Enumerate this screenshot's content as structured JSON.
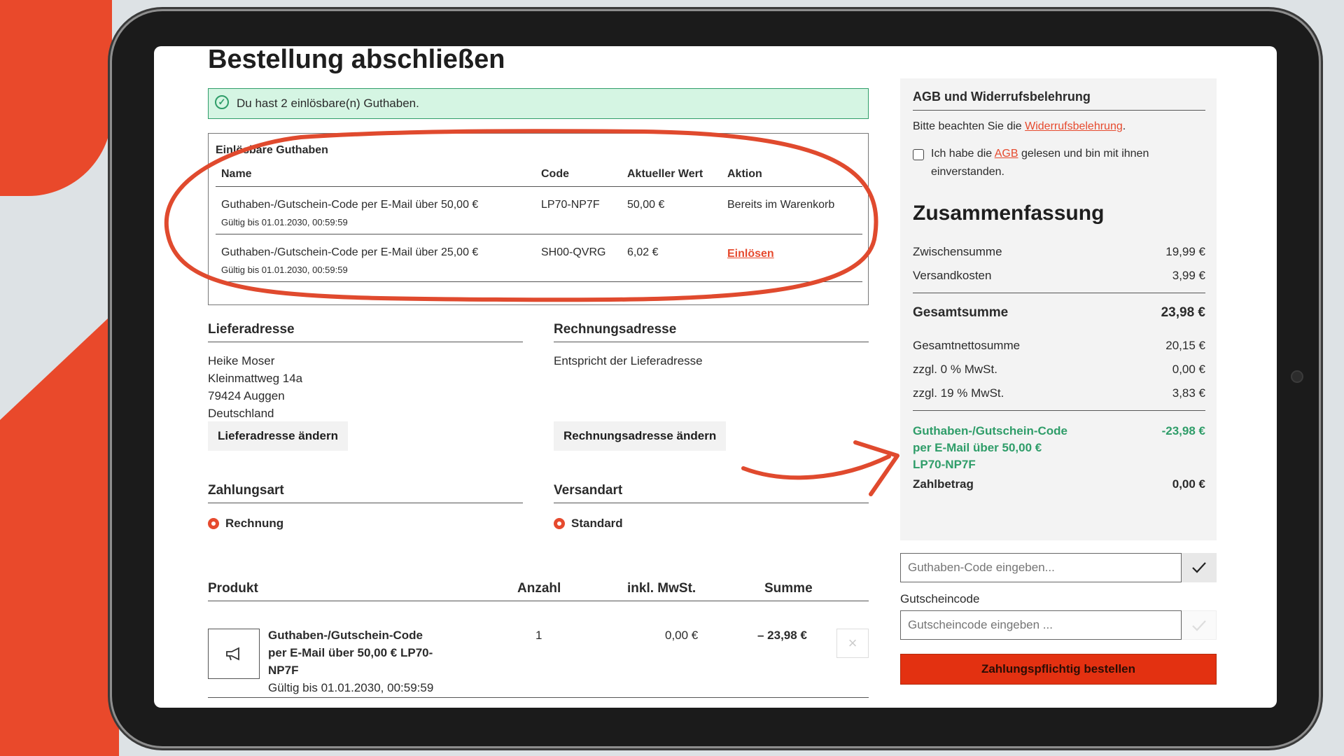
{
  "page": {
    "title": "Bestellung abschließen",
    "banner_text": "Du hast 2 einlösbare(n) Guthaben."
  },
  "credits": {
    "title": "Einlösbare Guthaben",
    "headers": [
      "Name",
      "Code",
      "Aktueller Wert",
      "Aktion"
    ],
    "rows": [
      {
        "name": "Guthaben-/Gutschein-Code per E-Mail über 50,00 €",
        "valid": "Gültig bis 01.01.2030, 00:59:59",
        "code": "LP70-NP7F",
        "value": "50,00 €",
        "action": "Bereits im Warenkorb"
      },
      {
        "name": "Guthaben-/Gutschein-Code per E-Mail über 25,00 €",
        "valid": "Gültig bis 01.01.2030, 00:59:59",
        "code": "SH00-QVRG",
        "value": "6,02 €",
        "action": "Einlösen"
      }
    ]
  },
  "shipping_address": {
    "title": "Lieferadresse",
    "lines": [
      "Heike Moser",
      "Kleinmattweg 14a",
      "79424 Auggen",
      "Deutschland"
    ],
    "button": "Lieferadresse ändern"
  },
  "billing_address": {
    "title": "Rechnungsadresse",
    "text": "Entspricht der Lieferadresse",
    "button": "Rechnungsadresse ändern"
  },
  "payment": {
    "title": "Zahlungsart",
    "option": "Rechnung"
  },
  "shipping_method": {
    "title": "Versandart",
    "option": "Standard"
  },
  "products": {
    "headers": [
      "Produkt",
      "Anzahl",
      "inkl. MwSt.",
      "Summe"
    ],
    "rows": [
      {
        "name": "Guthaben-/Gutschein-Code per E-Mail über 50,00 € LP70-NP7F",
        "name_lines": [
          "Guthaben-/Gutschein-Code",
          "per E-Mail über 50,00 € LP70-",
          "NP7F"
        ],
        "valid": "Gültig bis 01.01.2030, 00:59:59",
        "qty": "1",
        "price": "0,00 €",
        "total": "– 23,98 €"
      }
    ]
  },
  "terms": {
    "title": "AGB und Widerrufsbelehrung",
    "notice_prefix": "Bitte beachten Sie die ",
    "notice_link": "Widerrufsbelehrung",
    "notice_suffix": ".",
    "checkbox_prefix": "Ich habe die ",
    "checkbox_link": "AGB",
    "checkbox_suffix": " gelesen und bin mit ihnen",
    "checkbox_line2": "einverstanden."
  },
  "summary": {
    "title": "Zusammenfassung",
    "subtotal_label": "Zwischensumme",
    "subtotal": "19,99 €",
    "shipping_label": "Versandkosten",
    "shipping": "3,99 €",
    "total_label": "Gesamtsumme",
    "total": "23,98 €",
    "net_label": "Gesamtnettosumme",
    "net": "20,15 €",
    "vat0_label": "zzgl. 0 % MwSt.",
    "vat0": "0,00 €",
    "vat19_label": "zzgl. 19 % MwSt.",
    "vat19": "3,83 €",
    "credit_lines": [
      "Guthaben-/Gutschein-Code",
      "per E-Mail über 50,00 €",
      "LP70-NP7F"
    ],
    "credit_value": "-23,98 €",
    "pay_label": "Zahlbetrag",
    "pay": "0,00 €"
  },
  "credit_input": {
    "placeholder": "Guthaben-Code eingeben..."
  },
  "voucher": {
    "label": "Gutscheincode",
    "placeholder": "Gutscheincode eingeben ..."
  },
  "order_button": "Zahlungspflichtig bestellen",
  "colors": {
    "accent": "#e64a2e",
    "success": "#2f9d69",
    "order_button": "#e33111",
    "annotation": "#e04a2e"
  }
}
